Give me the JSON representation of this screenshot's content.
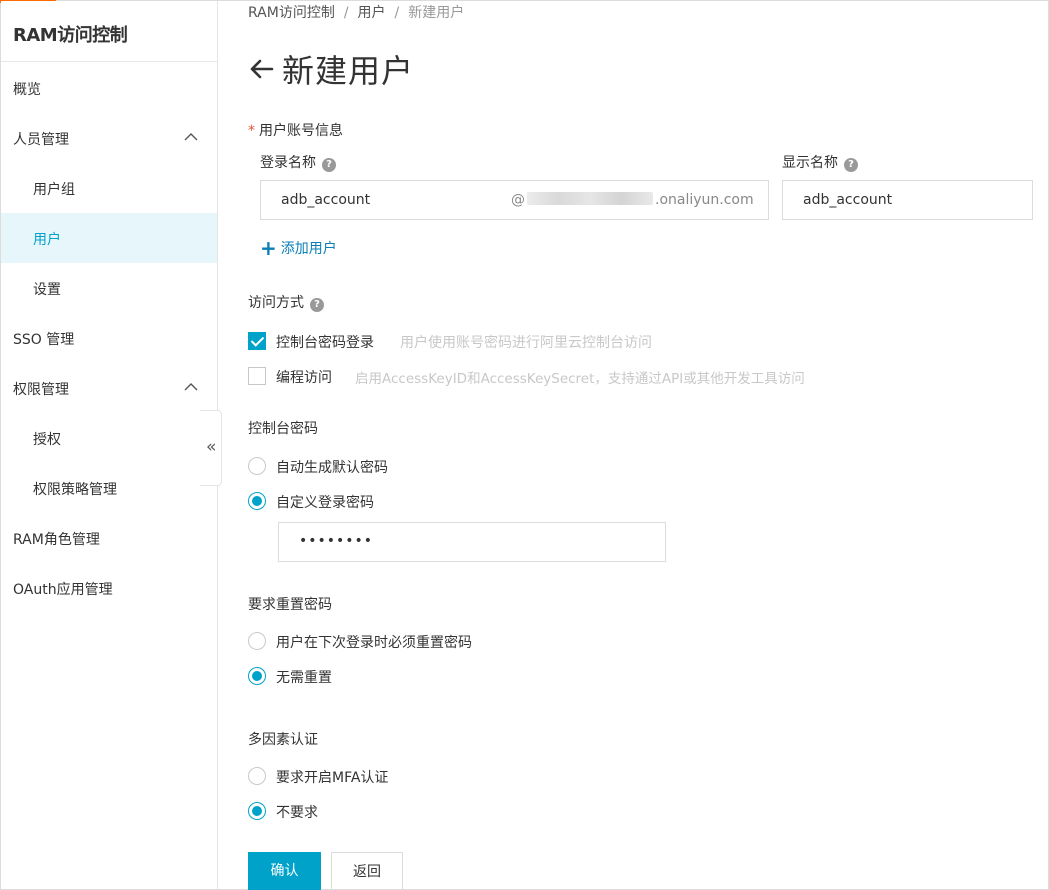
{
  "sidebar": {
    "title": "RAM访问控制",
    "items": [
      {
        "label": "概览"
      },
      {
        "label": "人员管理"
      },
      {
        "label": "用户组"
      },
      {
        "label": "用户"
      },
      {
        "label": "设置"
      },
      {
        "label": "SSO 管理"
      },
      {
        "label": "权限管理"
      },
      {
        "label": "授权"
      },
      {
        "label": "权限策略管理"
      },
      {
        "label": "RAM角色管理"
      },
      {
        "label": "OAuth应用管理"
      }
    ],
    "active_item": "用户",
    "collapse_glyph": "«"
  },
  "breadcrumb": {
    "items": [
      "RAM访问控制",
      "用户",
      "新建用户"
    ],
    "separator": "/"
  },
  "page": {
    "title": "新建用户"
  },
  "account_info": {
    "section_label": "用户账号信息",
    "required_mark": "*",
    "login_name_label": "登录名称",
    "display_name_label": "显示名称",
    "login_name_value": "adb_account",
    "domain_at": "@",
    "domain_suffix": ".onaliyun.com",
    "display_name_value": "adb_account",
    "add_user_label": "添加用户",
    "add_user_icon": "+"
  },
  "access_mode": {
    "label": "访问方式",
    "options": [
      {
        "label": "控制台密码登录",
        "hint": "用户使用账号密码进行阿里云控制台访问",
        "checked": true
      },
      {
        "label": "编程访问",
        "hint": "启用AccessKeyID和AccessKeySecret，支持通过API或其他开发工具访问",
        "checked": false
      }
    ]
  },
  "console_password": {
    "label": "控制台密码",
    "options": [
      {
        "label": "自动生成默认密码",
        "selected": false
      },
      {
        "label": "自定义登录密码",
        "selected": true
      }
    ],
    "password_value": "••••••••"
  },
  "reset_password": {
    "label": "要求重置密码",
    "options": [
      {
        "label": "用户在下次登录时必须重置密码",
        "selected": false
      },
      {
        "label": "无需重置",
        "selected": true
      }
    ]
  },
  "mfa": {
    "label": "多因素认证",
    "options": [
      {
        "label": "要求开启MFA认证",
        "selected": false
      },
      {
        "label": "不要求",
        "selected": true
      }
    ]
  },
  "actions": {
    "confirm_label": "确认",
    "back_label": "返回"
  },
  "help_glyph": "?",
  "colors": {
    "accent": "#00a2ca",
    "brand_top": "#ff6a00",
    "active_bg": "#e6f6fb",
    "link": "#0a7fb5",
    "required": "#e74c3c"
  }
}
